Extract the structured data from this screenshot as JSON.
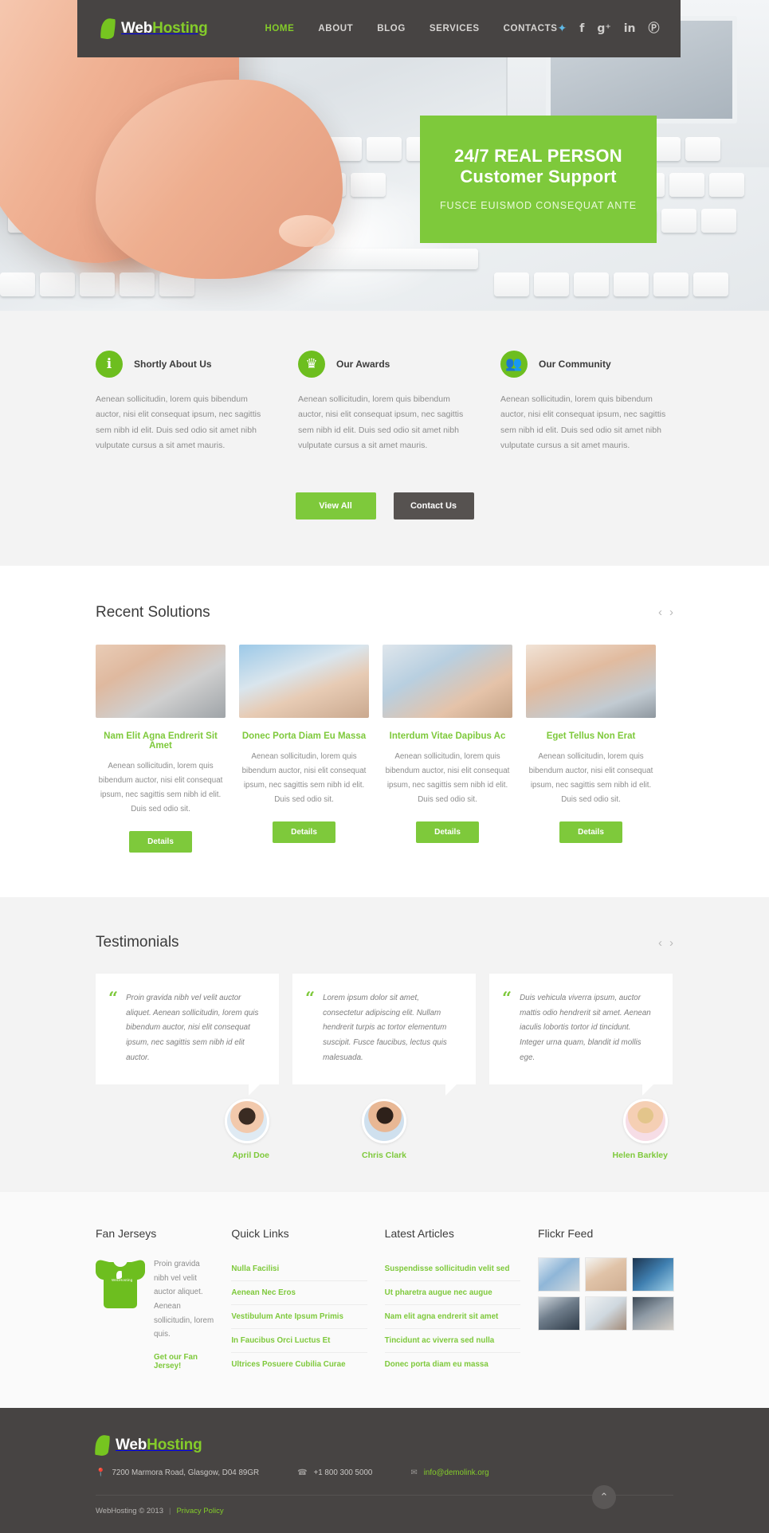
{
  "header": {
    "logo": {
      "name_first": "Web",
      "name_second": "Hosting",
      "icon": "leaf-icon"
    },
    "nav": [
      {
        "label": "HOME",
        "active": true
      },
      {
        "label": "ABOUT",
        "active": false
      },
      {
        "label": "BLOG",
        "active": false
      },
      {
        "label": "SERVICES",
        "active": false
      },
      {
        "label": "CONTACTS",
        "active": false
      }
    ],
    "socials": [
      {
        "name": "twitter-icon",
        "glyph": "🐦"
      },
      {
        "name": "facebook-icon",
        "glyph": "f"
      },
      {
        "name": "google-plus-icon",
        "glyph": "g+"
      },
      {
        "name": "linkedin-icon",
        "glyph": "in"
      },
      {
        "name": "pinterest-icon",
        "glyph": "Ⓟ"
      }
    ]
  },
  "hero": {
    "title_line1": "24/7 REAL PERSON",
    "title_line2": "Customer Support",
    "subtitle": "FUSCE EUISMOD CONSEQUAT ANTE",
    "accent_color": "#7ec93b"
  },
  "features": {
    "items": [
      {
        "icon": "info-icon",
        "glyph": "ℹ",
        "title": "Shortly About Us",
        "text": "Aenean sollicitudin, lorem quis bibendum auctor, nisi elit consequat ipsum, nec sagittis sem nibh id elit. Duis sed odio sit amet nibh vulputate cursus a sit amet mauris."
      },
      {
        "icon": "trophy-icon",
        "glyph": "♜",
        "title": "Our Awards",
        "text": "Aenean sollicitudin, lorem quis bibendum auctor, nisi elit consequat ipsum, nec sagittis sem nibh id elit. Duis sed odio sit amet nibh vulputate cursus a sit amet mauris."
      },
      {
        "icon": "community-icon",
        "glyph": "👥",
        "title": "Our Community",
        "text": "Aenean sollicitudin, lorem quis bibendum auctor, nisi elit consequat ipsum, nec sagittis sem nibh id elit. Duis sed odio sit amet nibh vulputate cursus a sit amet mauris."
      }
    ],
    "view_all_label": "View All",
    "contact_label": "Contact Us"
  },
  "solutions": {
    "heading": "Recent Solutions",
    "prev_arrow": "‹",
    "next_arrow": "›",
    "items": [
      {
        "title": "Nam Elit Agna Endrerit Sit Amet",
        "text": "Aenean sollicitudin, lorem quis bibendum auctor, nisi elit consequat ipsum, nec sagittis sem nibh id elit. Duis sed odio sit.",
        "button": "Details"
      },
      {
        "title": "Donec Porta Diam Eu Massa",
        "text": "Aenean sollicitudin, lorem quis bibendum auctor, nisi elit consequat ipsum, nec sagittis sem nibh id elit. Duis sed odio sit.",
        "button": "Details"
      },
      {
        "title": "Interdum Vitae Dapibus Ac",
        "text": "Aenean sollicitudin, lorem quis bibendum auctor, nisi elit consequat ipsum, nec sagittis sem nibh id elit. Duis sed odio sit.",
        "button": "Details"
      },
      {
        "title": "Eget Tellus Non Erat",
        "text": "Aenean sollicitudin, lorem quis bibendum auctor, nisi elit consequat ipsum, nec sagittis sem nibh id elit. Duis sed odio sit.",
        "button": "Details"
      }
    ]
  },
  "testimonials": {
    "heading": "Testimonials",
    "prev_arrow": "‹",
    "next_arrow": "›",
    "quote_glyph": "“",
    "items": [
      {
        "text": "Proin gravida nibh vel velit auctor aliquet. Aenean sollicitudin, lorem quis bibendum auctor, nisi elit consequat ipsum, nec sagittis sem nibh id elit auctor.",
        "author": "April Doe"
      },
      {
        "text": "Lorem ipsum dolor sit amet, consectetur adipiscing elit. Nullam hendrerit turpis ac tortor elementum suscipit. Fusce faucibus, lectus quis malesuada.",
        "author": "Chris Clark"
      },
      {
        "text": "Duis vehicula viverra ipsum, auctor mattis odio hendrerit sit amet. Aenean iaculis lobortis tortor id tincidunt. Integer urna quam, blandit id mollis ege.",
        "author": "Helen Barkley"
      }
    ]
  },
  "widgets": {
    "jersey": {
      "heading": "Fan Jerseys",
      "text": "Proin gravida nibh vel velit auctor aliquet. Aenean sollicitudin, lorem quis.",
      "link": "Get our Fan Jersey!",
      "shirt_mark": "WebHosting"
    },
    "quick_links": {
      "heading": "Quick Links",
      "items": [
        "Nulla Facilisi",
        "Aenean Nec Eros",
        "Vestibulum Ante Ipsum Primis",
        "In Faucibus Orci Luctus Et",
        "Ultrices Posuere Cubilia Curae"
      ]
    },
    "latest_articles": {
      "heading": "Latest Articles",
      "items": [
        "Suspendisse sollicitudin velit sed",
        "Ut pharetra augue nec augue",
        "Nam elit agna endrerit sit amet",
        "Tincidunt ac viverra sed nulla",
        "Donec porta diam eu massa"
      ]
    },
    "flickr": {
      "heading": "Flickr Feed",
      "thumbs": [
        "world-map-thumb",
        "woman-tablet-thumb",
        "man-globe-thumb",
        "man-tablet-thumb",
        "woman-laptop-thumb",
        "businessman-thumb"
      ]
    }
  },
  "footer": {
    "logo": {
      "name_first": "Web",
      "name_second": "Hosting"
    },
    "address": "7200  Marmora Road, Glasgow, D04 89GR",
    "phone": "+1 800 300 5000",
    "email": "info@demolink.org",
    "address_icon": "📍",
    "phone_icon": "☎",
    "email_icon": "✉",
    "copyright": "WebHosting © 2013",
    "separator": "|",
    "privacy": "Privacy Policy",
    "to_top_icon": "⌃"
  }
}
